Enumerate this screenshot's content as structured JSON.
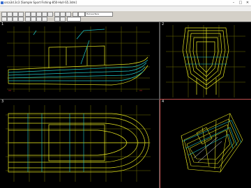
{
  "window": {
    "title": "orca3d.3c3 [Sample Sport Fishing-850-Hull-S5.3dm]",
    "min": "–",
    "max": "□",
    "close": "✕"
  },
  "menu": [
    "File",
    "Edit",
    "Analysis",
    "View",
    "Model",
    "Window",
    "Help"
  ],
  "toolbar": {
    "layer_field": "Hull-surface",
    "view_field": ""
  },
  "viewports": [
    {
      "label": "1",
      "kind": "profile"
    },
    {
      "label": "2",
      "kind": "front"
    },
    {
      "label": "3",
      "kind": "plan"
    },
    {
      "label": "4",
      "kind": "perspective"
    }
  ],
  "colors": {
    "grid": "#7a7a00",
    "hull": "#e8e820",
    "hull2": "#20c8c8",
    "active_border": "#c05050"
  }
}
